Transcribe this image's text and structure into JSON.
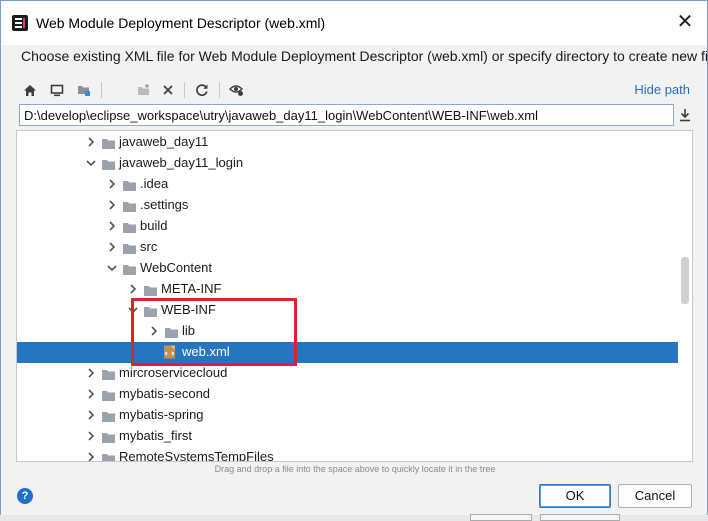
{
  "window": {
    "title": "Web Module Deployment Descriptor (web.xml)",
    "close_glyph": "✕"
  },
  "instruction": "Choose existing XML file for Web Module Deployment Descriptor (web.xml) or specify directory to create new file.",
  "toolbar": {
    "icons": [
      "home-icon",
      "desktop-icon",
      "project-icon",
      "new-folder-icon",
      "delete-icon",
      "refresh-icon",
      "show-hidden-icon"
    ],
    "hide_path": "Hide path"
  },
  "path": {
    "value": "D:\\develop\\eclipse_workspace\\utry\\javaweb_day11_login\\WebContent\\WEB-INF\\web.xml"
  },
  "tree": {
    "items": [
      {
        "label": "javaweb_day11",
        "expanded": false
      },
      {
        "label": "javaweb_day11_login",
        "expanded": true
      },
      {
        "label": ".idea",
        "expanded": false
      },
      {
        "label": ".settings",
        "expanded": false
      },
      {
        "label": "build",
        "expanded": false
      },
      {
        "label": "src",
        "expanded": false
      },
      {
        "label": "WebContent",
        "expanded": true
      },
      {
        "label": "META-INF",
        "expanded": false
      },
      {
        "label": "WEB-INF",
        "expanded": true
      },
      {
        "label": "lib",
        "expanded": false
      },
      {
        "label": "web.xml",
        "selected": true
      },
      {
        "label": "mircroservicecloud",
        "expanded": false
      },
      {
        "label": "mybatis-second",
        "expanded": false
      },
      {
        "label": "mybatis-spring",
        "expanded": false
      },
      {
        "label": "mybatis_first",
        "expanded": false
      },
      {
        "label": "RemoteSystemsTempFiles",
        "expanded": false
      }
    ]
  },
  "hint": "Drag and drop a file into the space above to quickly locate it in the tree",
  "buttons": {
    "help": "?",
    "ok": "OK",
    "cancel": "Cancel"
  },
  "colors": {
    "selection": "#2675bf",
    "highlight_box": "#e0202a",
    "link": "#2a6ebe"
  }
}
